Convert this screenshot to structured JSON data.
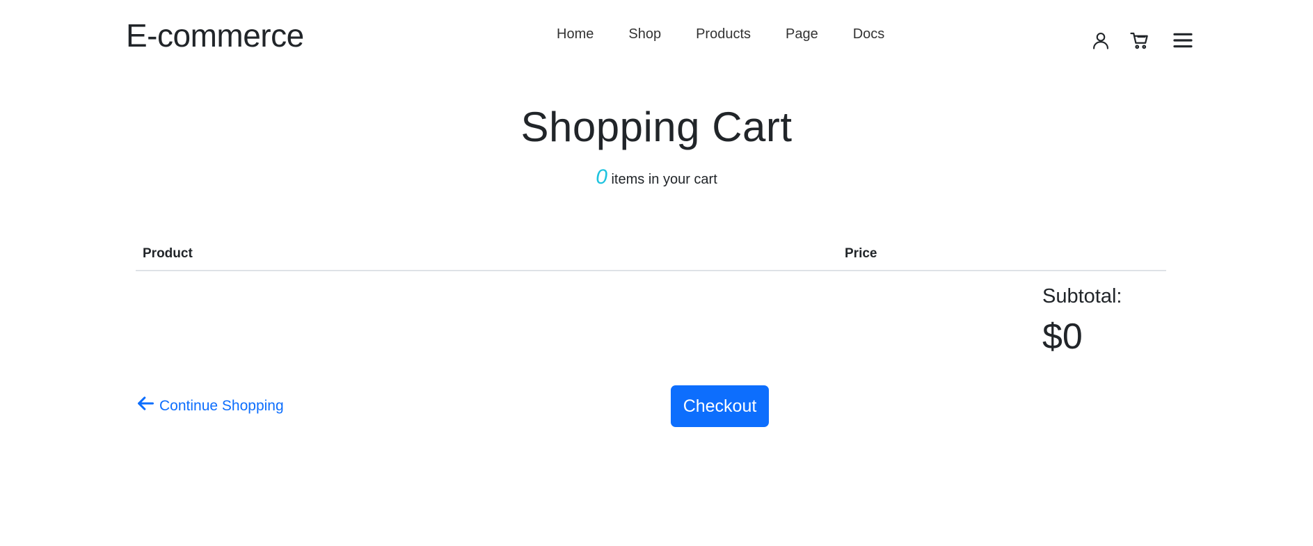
{
  "navbar": {
    "brand": "E-commerce",
    "links": [
      "Home",
      "Shop",
      "Products",
      "Page",
      "Docs"
    ],
    "icons": [
      "user-icon",
      "cart-icon",
      "menu-icon"
    ]
  },
  "cart": {
    "title": "Shopping Cart",
    "item_count": "0",
    "item_count_text": " items in your cart",
    "columns": [
      "Product",
      "Price"
    ],
    "subtotal_label": "Subtotal:",
    "subtotal_value": "$0",
    "continue_label": "Continue Shopping",
    "checkout_label": "Checkout"
  },
  "colors": {
    "accent": "#0d6efd",
    "count": "#1ec3df",
    "text": "#212529"
  }
}
